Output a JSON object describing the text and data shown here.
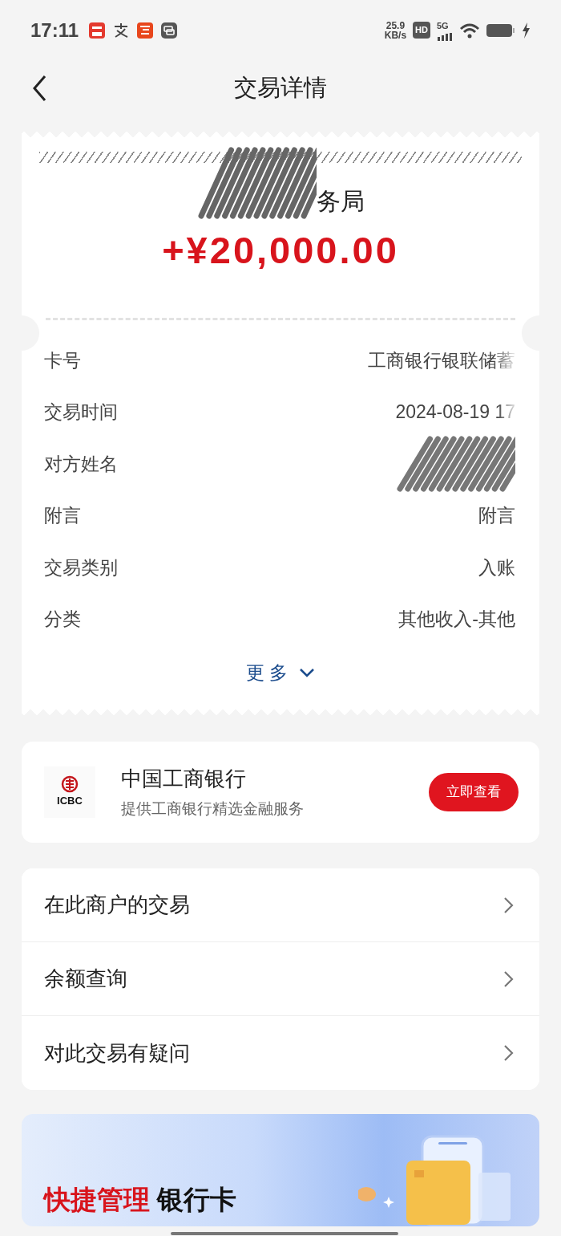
{
  "status_bar": {
    "time": "17:11",
    "net_speed": "25.9",
    "net_speed_unit": "KB/s",
    "hd": "HD",
    "network": "5G"
  },
  "header": {
    "title": "交易详情"
  },
  "receipt": {
    "merchant": "务局",
    "merchant_redacted": true,
    "amount": "+¥20,000.00",
    "details": [
      {
        "label": "卡号",
        "value": "工商银行银联储蓄",
        "faded": true
      },
      {
        "label": "交易时间",
        "value": "2024-08-19 17",
        "faded": true
      },
      {
        "label": "对方姓名",
        "redacted": true
      },
      {
        "label": "附言",
        "value": "附言"
      },
      {
        "label": "交易类别",
        "value": "入账"
      },
      {
        "label": "分类",
        "value": "其他收入-其他"
      }
    ],
    "more": "更多"
  },
  "bank_promo": {
    "logo_text": "ICBC",
    "name": "中国工商银行",
    "subtitle": "提供工商银行精选金融服务",
    "button": "立即查看"
  },
  "actions": [
    {
      "label": "在此商户的交易"
    },
    {
      "label": "余额查询"
    },
    {
      "label": "对此交易有疑问"
    }
  ],
  "banner": {
    "title_highlight": "快捷管理",
    "title_rest": "银行卡"
  }
}
